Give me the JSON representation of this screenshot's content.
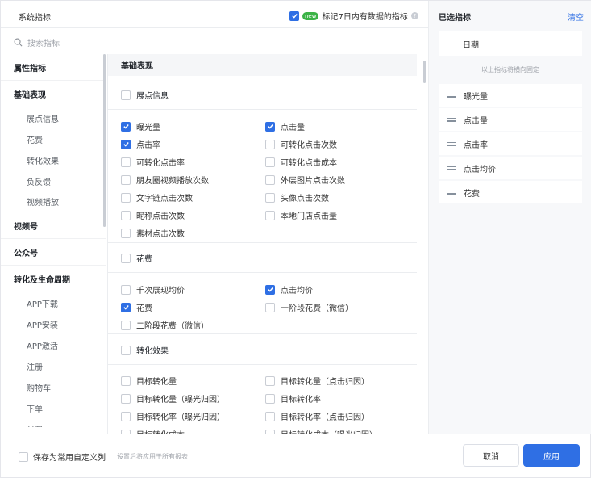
{
  "header": {
    "tab_label": "系统指标",
    "mark_badge": "new",
    "mark_label": "标记7日内有数据的指标",
    "help_icon": "?"
  },
  "search": {
    "placeholder": "搜索指标",
    "icon": "search-icon"
  },
  "left_nav": {
    "groups": [
      {
        "label": "属性指标",
        "items": []
      },
      {
        "label": "基础表现",
        "items": [
          "展点信息",
          "花费",
          "转化效果",
          "负反馈",
          "视频播放"
        ]
      },
      {
        "label": "视频号",
        "items": []
      },
      {
        "label": "公众号",
        "items": []
      },
      {
        "label": "转化及生命周期",
        "items": [
          "APP下载",
          "APP安装",
          "APP激活",
          "注册",
          "购物车",
          "下单",
          "付费"
        ]
      }
    ]
  },
  "middle": {
    "section_header": "基础表现",
    "categories": [
      {
        "label": "展点信息"
      },
      {
        "label": "花费"
      },
      {
        "label": "转化效果"
      }
    ],
    "exposure_options": [
      {
        "label": "曝光量",
        "checked": true
      },
      {
        "label": "点击量",
        "checked": true
      },
      {
        "label": "点击率",
        "checked": true
      },
      {
        "label": "可转化点击次数",
        "checked": false
      },
      {
        "label": "可转化点击率",
        "checked": false
      },
      {
        "label": "可转化点击成本",
        "checked": false
      },
      {
        "label": "朋友圈视频播放次数",
        "checked": false
      },
      {
        "label": "外层图片点击次数",
        "checked": false
      },
      {
        "label": "文字链点击次数",
        "checked": false
      },
      {
        "label": "头像点击次数",
        "checked": false
      },
      {
        "label": "昵称点击次数",
        "checked": false
      },
      {
        "label": "本地门店点击量",
        "checked": false
      },
      {
        "label": "素材点击次数",
        "checked": false
      }
    ],
    "cost_options": [
      {
        "label": "千次展现均价",
        "checked": false
      },
      {
        "label": "点击均价",
        "checked": true
      },
      {
        "label": "花费",
        "checked": true
      },
      {
        "label": "一阶段花费（微信）",
        "checked": false
      },
      {
        "label": "二阶段花费（微信）",
        "checked": false
      }
    ],
    "conversion_options": [
      {
        "label": "目标转化量",
        "checked": false
      },
      {
        "label": "目标转化量（点击归因）",
        "checked": false
      },
      {
        "label": "目标转化量（曝光归因）",
        "checked": false
      },
      {
        "label": "目标转化率",
        "checked": false
      },
      {
        "label": "目标转化率（曝光归因）",
        "checked": false
      },
      {
        "label": "目标转化率（点击归因）",
        "checked": false
      },
      {
        "label": "目标转化成本",
        "checked": false
      },
      {
        "label": "目标转化成本（曝光归因）",
        "checked": false
      }
    ]
  },
  "selected": {
    "title": "已选指标",
    "clear_label": "清空",
    "fixed_item": "日期",
    "fixed_hint": "以上指标将横向固定",
    "items": [
      "曝光量",
      "点击量",
      "点击率",
      "点击均价",
      "花费"
    ]
  },
  "footer": {
    "save_label": "保存为常用自定义列",
    "save_hint": "设置后将应用于所有报表",
    "cancel_label": "取消",
    "apply_label": "应用"
  },
  "colors": {
    "accent": "#2f6fe4",
    "badge": "#3bb346"
  }
}
